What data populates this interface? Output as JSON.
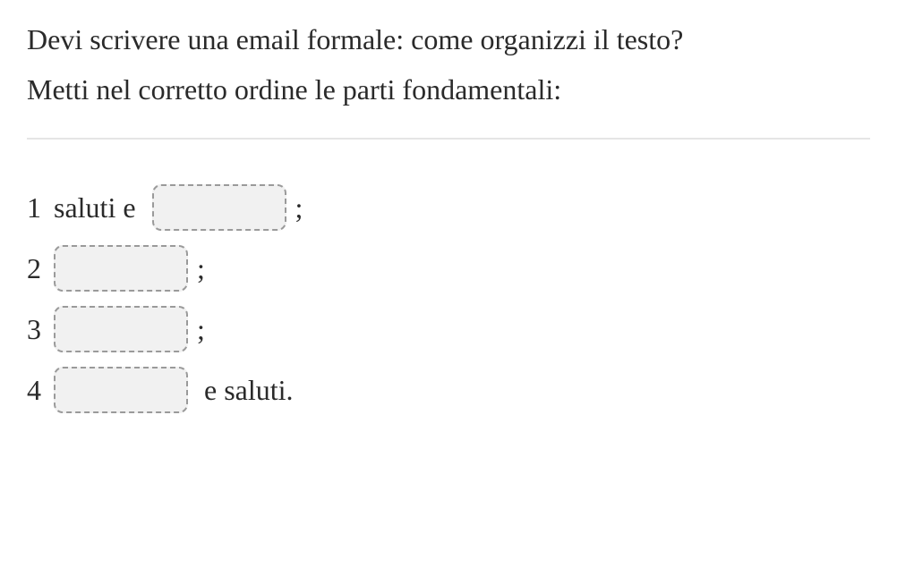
{
  "prompt": {
    "line1": "Devi scrivere una email formale: come organizzi il testo?",
    "line2": "Metti nel corretto ordine le parti fondamentali:"
  },
  "rows": [
    {
      "number": "1",
      "before_text": "saluti e ",
      "after_text": ";"
    },
    {
      "number": "2",
      "before_text": "",
      "after_text": ";"
    },
    {
      "number": "3",
      "before_text": "",
      "after_text": ";"
    },
    {
      "number": "4",
      "before_text": "",
      "after_text": " e saluti."
    }
  ]
}
